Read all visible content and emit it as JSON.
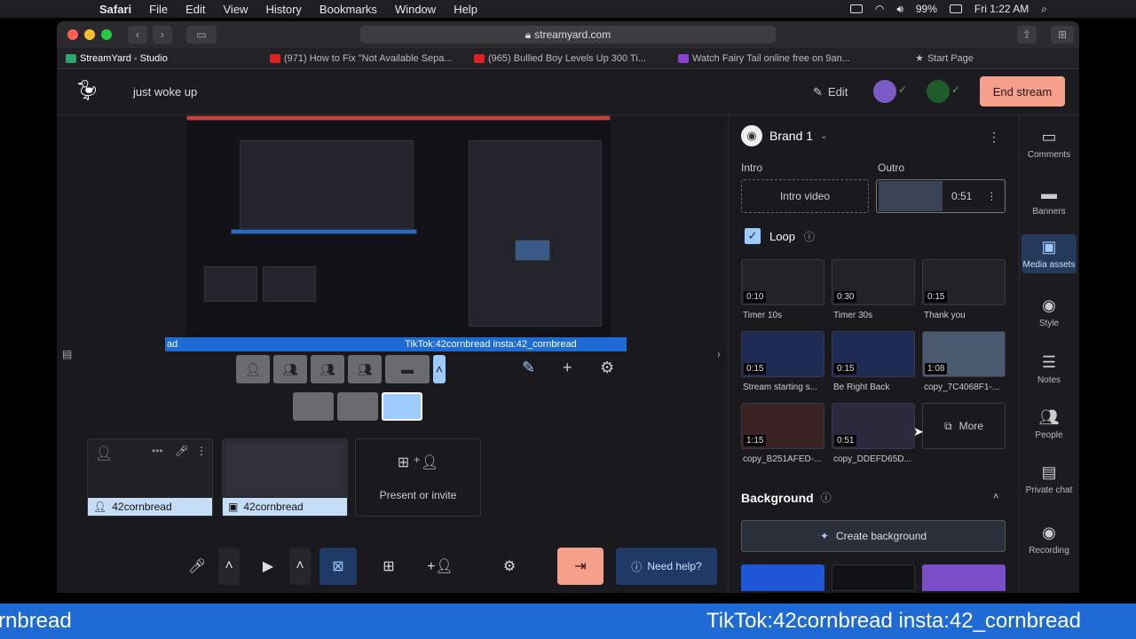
{
  "menubar": {
    "app": "Safari",
    "items": [
      "File",
      "Edit",
      "View",
      "History",
      "Bookmarks",
      "Window",
      "Help"
    ],
    "battery": "99%",
    "clock": "Fri 1:22 AM"
  },
  "browser": {
    "url": "streamyard.com",
    "tabs": [
      {
        "label": "StreamYard - Studio",
        "color": "#2fa36b"
      },
      {
        "label": "(971) How to Fix \"Not Available Sepa...",
        "color": "#e02020"
      },
      {
        "label": "(965) Bullied Boy Levels Up 300 Ti...",
        "color": "#e02020"
      },
      {
        "label": "Watch Fairy Tail online free on 9an...",
        "color": "#8a3fd1"
      },
      {
        "label": "Start Page",
        "color": "#888888"
      }
    ]
  },
  "header": {
    "title": "just woke up",
    "edit_label": "Edit",
    "end_stream_label": "End stream",
    "accent": "#f4a08a"
  },
  "studio": {
    "banner_left": "ad",
    "banner_text": "TikTok:42cornbread insta:42_cornbread",
    "sources": [
      {
        "label": "42cornbread"
      },
      {
        "label": "42cornbread"
      }
    ],
    "present_label": "Present or invite",
    "need_help_label": "Need help?"
  },
  "panel": {
    "brand_name": "Brand 1",
    "intro_label": "Intro",
    "outro_label": "Outro",
    "intro_video_label": "Intro video",
    "outro_duration": "0:51",
    "loop_label": "Loop",
    "assets": [
      {
        "name": "Timer 10s",
        "duration": "0:10"
      },
      {
        "name": "Timer 30s",
        "duration": "0:30"
      },
      {
        "name": "Thank you",
        "duration": "0:15"
      },
      {
        "name": "Stream starting s...",
        "duration": "0:15"
      },
      {
        "name": "Be Right Back",
        "duration": "0:15"
      },
      {
        "name": "copy_7C4068F1-...",
        "duration": "1:08"
      },
      {
        "name": "copy_B251AFED-...",
        "duration": "1:15"
      },
      {
        "name": "copy_DDEFD65D...",
        "duration": "0:51"
      }
    ],
    "more_label": "More",
    "background_title": "Background",
    "create_background_label": "Create background"
  },
  "rail": [
    {
      "label": "Comments",
      "icon": "comment-icon"
    },
    {
      "label": "Banners",
      "icon": "banner-icon"
    },
    {
      "label": "Media assets",
      "icon": "media-icon"
    },
    {
      "label": "Style",
      "icon": "palette-icon"
    },
    {
      "label": "Notes",
      "icon": "notes-icon"
    },
    {
      "label": "People",
      "icon": "people-icon"
    },
    {
      "label": "Private chat",
      "icon": "chat-icon"
    },
    {
      "label": "Recording",
      "icon": "record-icon"
    }
  ],
  "ticker": {
    "left": "rnbread",
    "right": "TikTok:42cornbread insta:42_cornbread"
  }
}
